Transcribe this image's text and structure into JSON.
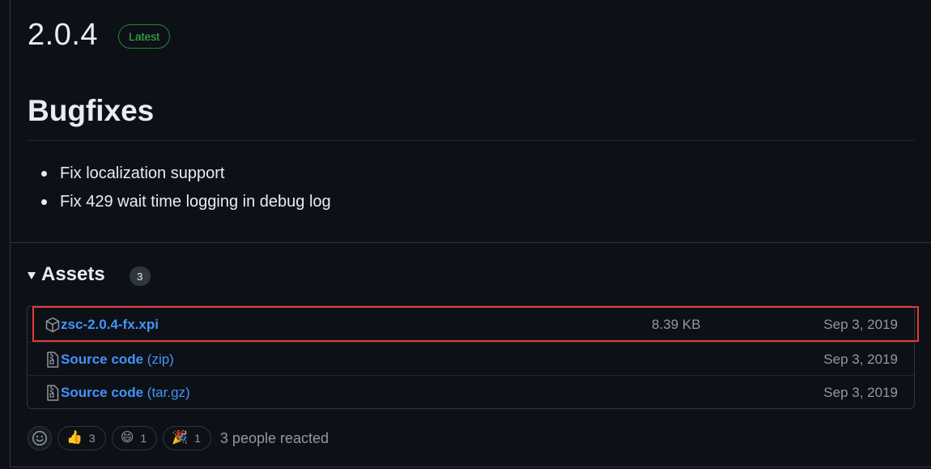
{
  "release": {
    "version": "2.0.4",
    "latest_badge": "Latest",
    "heading": "Bugfixes",
    "notes": [
      "Fix localization support",
      "Fix 429 wait time logging in debug log"
    ]
  },
  "assets": {
    "title": "Assets",
    "count": "3",
    "items": [
      {
        "name": "zsc-2.0.4-fx.xpi",
        "suffix": "",
        "size": "8.39 KB",
        "date": "Sep 3, 2019",
        "icon": "package-icon",
        "highlighted": true
      },
      {
        "name": "Source code",
        "suffix": "(zip)",
        "size": "",
        "date": "Sep 3, 2019",
        "icon": "file-zip-icon",
        "highlighted": false
      },
      {
        "name": "Source code",
        "suffix": "(tar.gz)",
        "size": "",
        "date": "Sep 3, 2019",
        "icon": "file-zip-icon",
        "highlighted": false
      }
    ]
  },
  "reactions": {
    "items": [
      {
        "emoji": "👍",
        "count": "3",
        "icon": "thumbs-up-icon"
      },
      {
        "emoji": "😄",
        "count": "1",
        "icon": "smile-icon"
      },
      {
        "emoji": "🎉",
        "count": "1",
        "icon": "tada-icon"
      }
    ],
    "summary": "3 people reacted"
  },
  "colors": {
    "background": "#0d1117",
    "link": "#4493f8",
    "latest_green": "#3fb950",
    "highlight_red": "#e5383b",
    "muted": "#9198a1"
  }
}
